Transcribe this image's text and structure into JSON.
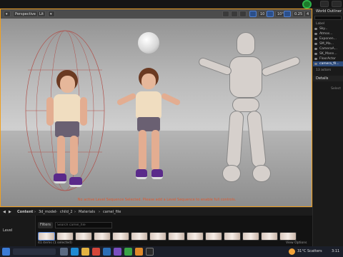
{
  "toolbar": {
    "perspective_label": "Perspective",
    "lit_label": "Lit",
    "snap_values": [
      "10",
      "10°",
      "0.25"
    ],
    "viewport_count": "4"
  },
  "viewport": {
    "message": "No active Level Sequence Selected. Please add a Level Sequence to enable full controls."
  },
  "outliner": {
    "title": "World Outliner",
    "column_label": "Label",
    "items": [
      "Sky...",
      "Atmos...",
      "Exponen...",
      "SM_Ma...",
      "CameraA...",
      "SK_Mann...",
      "FloorActor",
      "camera_fil..."
    ],
    "actor_count": "13 actors",
    "details_title": "Details",
    "select_hint": "Select"
  },
  "content_browser": {
    "root": "Content",
    "path": [
      "3d_model",
      "child_2",
      "Materials",
      "camel_file"
    ],
    "filters_label": "Filters",
    "search_placeholder": "Search camel_file",
    "folder_label": "Level",
    "status": "41 items (1 selected)",
    "view_options": "View Options"
  },
  "taskbar": {
    "weather": "31°C Scatters",
    "time": "3:11"
  },
  "colors": {
    "accent_orange": "#f0a020",
    "selection_blue": "#2c4a7a",
    "warning_red": "#e05a30",
    "shoe_purple": "#5a2a8a"
  }
}
